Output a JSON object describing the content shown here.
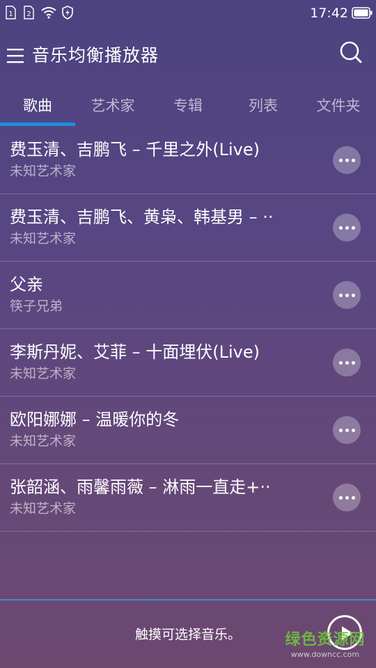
{
  "status_bar": {
    "sim1_label": "1",
    "sim2_label": "2",
    "time": "17:42"
  },
  "app_bar": {
    "title": "音乐均衡播放器"
  },
  "tabs": [
    {
      "label": "歌曲",
      "active": true
    },
    {
      "label": "艺术家",
      "active": false
    },
    {
      "label": "专辑",
      "active": false
    },
    {
      "label": "列表",
      "active": false
    },
    {
      "label": "文件夹",
      "active": false
    }
  ],
  "songs": [
    {
      "title": "费玉清、吉鹏飞 – 千里之外(Live)",
      "artist": "未知艺术家"
    },
    {
      "title": "费玉清、吉鹏飞、黄枭、韩基男 – ··",
      "artist": "未知艺术家"
    },
    {
      "title": "父亲",
      "artist": "筷子兄弟"
    },
    {
      "title": "李斯丹妮、艾菲 – 十面埋伏(Live)",
      "artist": "未知艺术家"
    },
    {
      "title": "欧阳娜娜 – 温暖你的冬",
      "artist": "未知艺术家"
    },
    {
      "title": "张韶涵、雨馨雨薇 – 淋雨一直走+··",
      "artist": "未知艺术家"
    }
  ],
  "player": {
    "hint": "触摸可选择音乐。"
  },
  "watermark": {
    "main": "绿色资源网",
    "url": "www.downcc.com"
  },
  "colors": {
    "background_top": "#4c4380",
    "background_bottom": "#6c4870",
    "accent": "#1a8fe0"
  }
}
